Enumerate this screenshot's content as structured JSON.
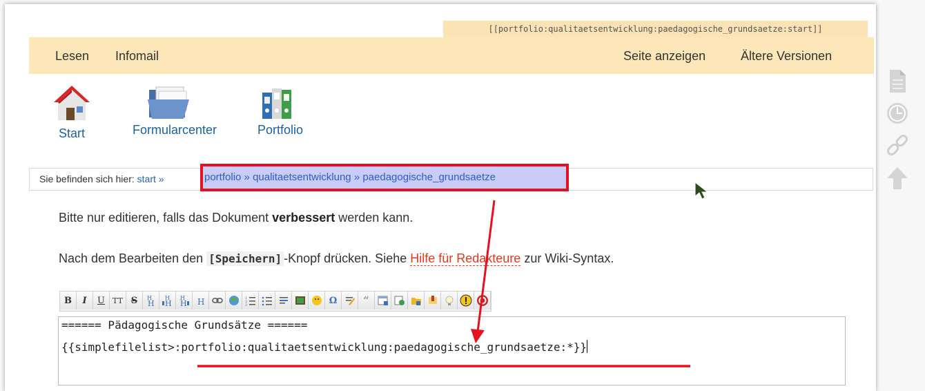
{
  "pagename": "[[portfolio:qualitaetsentwicklung:paedagogische_grundsaetze:start]]",
  "topbar": {
    "left": [
      "Lesen",
      "Infomail"
    ],
    "right": [
      "Seite anzeigen",
      "Ältere Versionen"
    ]
  },
  "shortcuts": [
    {
      "label": "Start",
      "icon": "home-icon"
    },
    {
      "label": "Formularcenter",
      "icon": "folder-icon"
    },
    {
      "label": "Portfolio",
      "icon": "binders-icon"
    }
  ],
  "breadcrumb": {
    "prefix": "Sie befinden sich hier:",
    "start": "start",
    "sep": "»",
    "items": [
      "portfolio",
      "qualitaetsentwicklung",
      "paedagogische_grundsaetze"
    ]
  },
  "messages": {
    "line1_pre": "Bitte nur editieren, falls das Dokument ",
    "line1_bold": "verbessert",
    "line1_post": " werden kann.",
    "line2_pre": "Nach dem Bearbeiten den ",
    "line2_code": "[Speichern]",
    "line2_mid": "-Knopf drücken. Siehe ",
    "line2_link": "Hilfe für Redakteure",
    "line2_post": " zur Wiki-Syntax."
  },
  "editor": {
    "line1": "====== Pädagogische Grundsätze ======",
    "line2_pre": "{{simplefilelist>",
    "line2_path": ":portfolio:qualitaetsentwicklung:paedagogische_grundsaetze:*",
    "line2_post": "}}"
  },
  "toolbar": {
    "bold": "B",
    "italic": "I",
    "underline": "U",
    "mono": "TT",
    "strike": "S"
  },
  "colors": {
    "accent_bar": "#fde7b9",
    "link": "#2366b0",
    "annotation_red": "#e8101f",
    "highlight": "#c9ccf7"
  }
}
